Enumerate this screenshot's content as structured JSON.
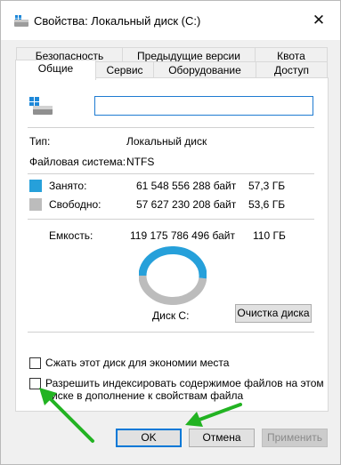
{
  "window": {
    "title": "Свойства: Локальный диск (C:)",
    "close_glyph": "✕"
  },
  "tabs": {
    "row1": [
      "Безопасность",
      "Предыдущие версии",
      "Квота"
    ],
    "row2": [
      "Общие",
      "Сервис",
      "Оборудование",
      "Доступ"
    ],
    "active": "Общие"
  },
  "general": {
    "name_value": "",
    "type_label": "Тип:",
    "type_value": "Локальный диск",
    "fs_label": "Файловая система:",
    "fs_value": "NTFS",
    "used_label": "Занято:",
    "used_bytes": "61 548 556 288 байт",
    "used_size": "57,3 ГБ",
    "free_label": "Свободно:",
    "free_bytes": "57 627 230 208 байт",
    "free_size": "53,6 ГБ",
    "capacity_label": "Емкость:",
    "capacity_bytes": "119 175 786 496 байт",
    "capacity_size": "110 ГБ",
    "disk_label": "Диск C:",
    "cleanup_button": "Очистка диска",
    "compress_label": "Сжать этот диск для экономии места",
    "index_label_line1": "Разрешить индексировать содержимое файлов на этом",
    "index_label_line2": "диске в дополнение к свойствам файла"
  },
  "usage": {
    "used_fraction": 0.516,
    "used_color": "#26a0da",
    "free_color": "#bcbcbc"
  },
  "buttons": {
    "ok": "OK",
    "cancel": "Отмена",
    "apply": "Применить"
  },
  "annotations": {
    "arrow_color": "#22b322"
  },
  "icons": {
    "title": "drive-icon",
    "drive_large": "windows-drive-icon"
  }
}
